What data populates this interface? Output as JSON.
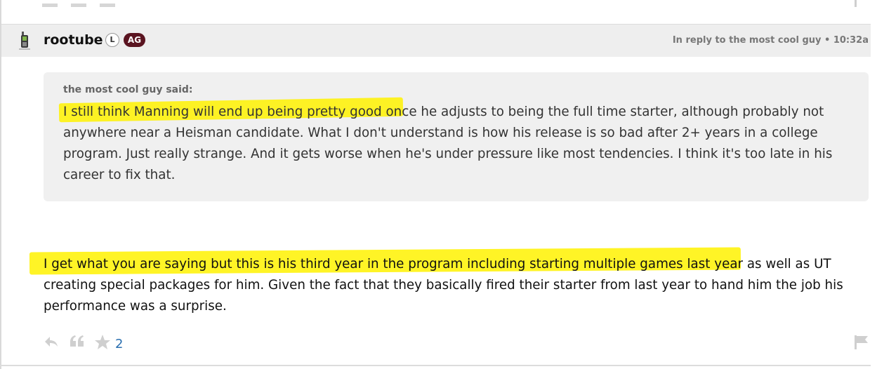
{
  "post": {
    "username": "rootube",
    "badge_l": "L",
    "badge_ag": "AG",
    "reply_meta": "In reply to the most cool guy • 10:32a",
    "quote_author": "the most cool guy said:",
    "quote_text": "I still think Manning will end up being pretty good once he adjusts to being the full time starter, although probably not anywhere near a Heisman candidate. What I don't understand is how his release is so bad after 2+ years in a college program. Just really strange. And it gets worse when he's under pressure like most tendencies. I think it's too late in his career to fix that.",
    "body_text": "I get what you are saying but this is his third year in the program including starting multiple games last year as well as UT creating special packages for him. Given the fact that they basically fired their starter from last year to hand him the job his performance was a surprise.",
    "star_count": "2"
  },
  "icons": {
    "avatar": "phone-icon",
    "reply": "reply-icon",
    "quote": "quote-icon",
    "star": "star-icon",
    "flag": "flag-icon"
  },
  "colors": {
    "highlight": "#fff200",
    "badge_ag": "#5a1420",
    "star_count": "#2a6fb0"
  }
}
